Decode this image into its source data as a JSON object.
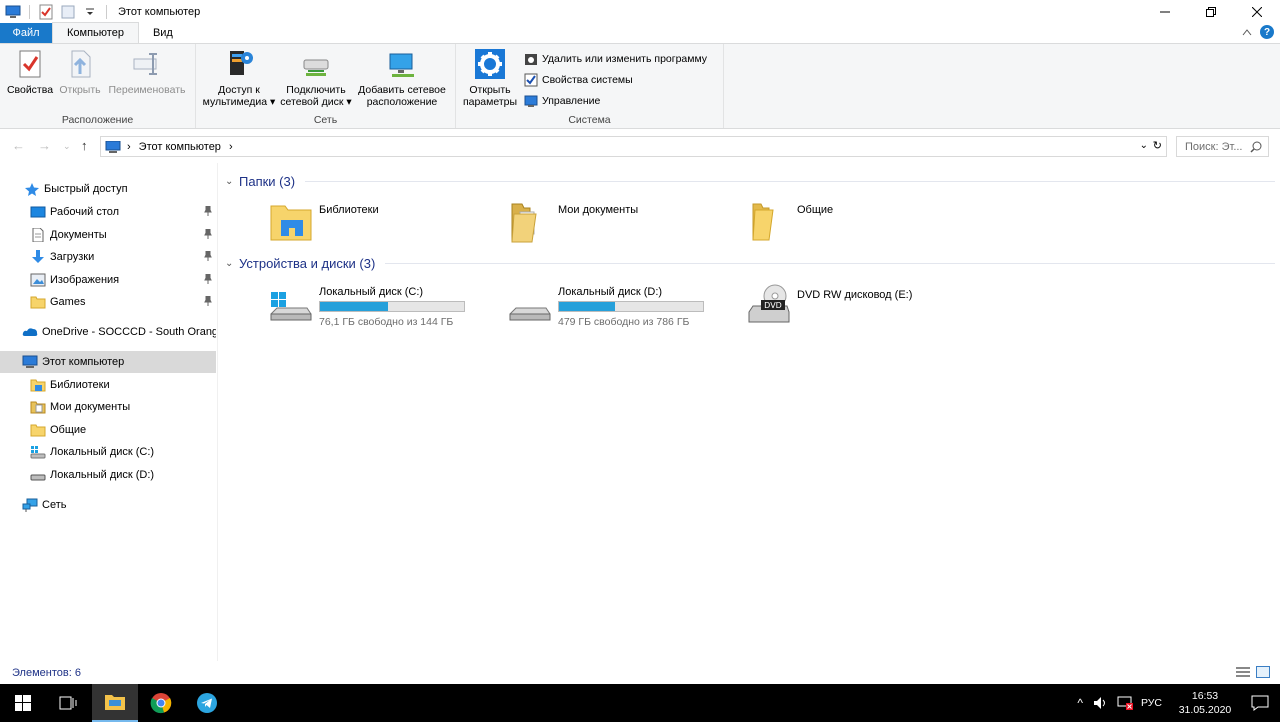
{
  "window": {
    "title": "Этот компьютер"
  },
  "tabs": {
    "file": "Файл",
    "computer": "Компьютер",
    "view": "Вид"
  },
  "ribbon": {
    "location": {
      "label": "Расположение",
      "properties": "Свойства",
      "open": "Открыть",
      "rename": "Переименовать"
    },
    "network": {
      "label": "Сеть",
      "media_line1": "Доступ к",
      "media_line2": "мультимедиа",
      "map_line1": "Подключить",
      "map_line2": "сетевой диск",
      "add_line1": "Добавить сетевое",
      "add_line2": "расположение"
    },
    "system": {
      "label": "Система",
      "open_line1": "Открыть",
      "open_line2": "параметры",
      "uninstall": "Удалить или изменить программу",
      "sysprops": "Свойства системы",
      "manage": "Управление"
    }
  },
  "address": {
    "path": "Этот компьютер",
    "search_placeholder": "Поиск: Эт..."
  },
  "sidebar": {
    "quick_access": "Быстрый доступ",
    "quick_items": [
      "Рабочий стол",
      "Документы",
      "Загрузки",
      "Изображения",
      "Games"
    ],
    "onedrive": "OneDrive - SOCCCD - South Orang",
    "this_pc": "Этот компьютер",
    "pc_items": [
      "Библиотеки",
      "Мои документы",
      "Общие",
      "Локальный диск (C:)",
      "Локальный диск (D:)"
    ],
    "network": "Сеть"
  },
  "content": {
    "folders_header": "Папки (3)",
    "folders": [
      "Библиотеки",
      "Мои документы",
      "Общие"
    ],
    "devices_header": "Устройства и диски (3)",
    "drives": [
      {
        "name": "Локальный диск (C:)",
        "free": "76,1 ГБ свободно из 144 ГБ",
        "used_fraction": 0.47
      },
      {
        "name": "Локальный диск (D:)",
        "free": "479 ГБ свободно из 786 ГБ",
        "used_fraction": 0.39
      }
    ],
    "dvd": {
      "name": "DVD RW дисковод (E:)",
      "badge": "DVD"
    }
  },
  "status": {
    "items": "Элементов: 6"
  },
  "taskbar": {
    "lang": "РУС",
    "time": "16:53",
    "date": "31.05.2020"
  },
  "colors": {
    "accent": "#1979ca",
    "drive_fill": "#26a0da",
    "selected": "#d9d9d9"
  }
}
